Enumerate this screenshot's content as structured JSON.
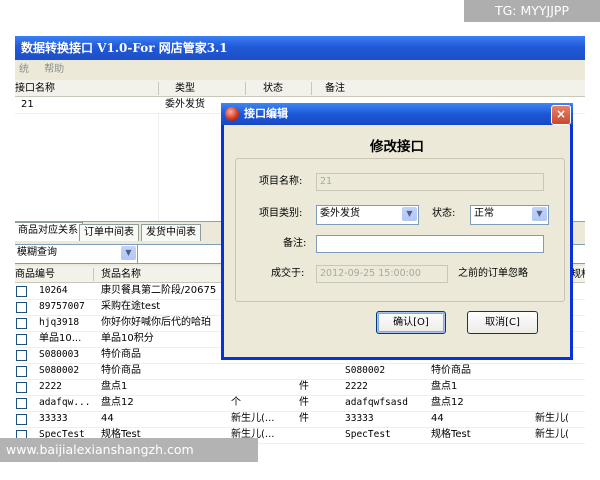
{
  "app": {
    "title": "数据转换接口 V1.0-For 网店管家3.1",
    "menu": [
      "统",
      "帮助"
    ]
  },
  "top_grid": {
    "columns": [
      "接口名称",
      "类型",
      "状态",
      "备注"
    ],
    "rows": [
      {
        "name": "21",
        "type": "委外发货",
        "status": "",
        "note": ""
      }
    ]
  },
  "tabs": [
    "商品对应关系",
    "订单中间表",
    "发货中间表"
  ],
  "filter": {
    "mode": "模糊查询",
    "text": ""
  },
  "bottom_grid": {
    "columns": [
      "商品编号",
      "货品名称",
      "",
      "",
      "",
      "",
      "",
      "规格"
    ],
    "rows": [
      [
        "10264",
        "康贝餐具第二阶段/20675",
        "",
        "",
        "",
        "",
        ""
      ],
      [
        "89757007",
        "采购在途test",
        "",
        "",
        "",
        "",
        ""
      ],
      [
        "hjq3918",
        "你好你好喊你后代的哈珀",
        "",
        "",
        "",
        "",
        ""
      ],
      [
        "单品10...",
        "单品10积分",
        "",
        "",
        "",
        "",
        ""
      ],
      [
        "S080003",
        "特价商品",
        "",
        "",
        "",
        "",
        ""
      ],
      [
        "S080002",
        "特价商品",
        "",
        "",
        "S080002",
        "特价商品",
        ""
      ],
      [
        "2222",
        "盘点1",
        "",
        "件",
        "2222",
        "盘点1",
        ""
      ],
      [
        "adafqw...",
        "盘点12",
        "个",
        "件",
        "adafqwfsasd",
        "盘点12",
        ""
      ],
      [
        "33333",
        "44",
        "新生儿(...",
        "件",
        "33333",
        "44",
        "新生儿("
      ],
      [
        "SpecTest",
        "规格Test",
        "新生儿(...",
        "",
        "SpecTest",
        "规格Test",
        "新生儿("
      ]
    ]
  },
  "dialog": {
    "title": "接口编辑",
    "heading": "修改接口",
    "name_label": "项目名称:",
    "name_value": "21",
    "type_label": "项目类别:",
    "type_value": "委外发货",
    "status_label": "状态:",
    "status_value": "正常",
    "note_label": "备注:",
    "note_value": "",
    "since_label": "成交于:",
    "since_value": "2012-09-25 15:00:00",
    "since_suffix": "之前的订单忽略",
    "ok_label": "确认[O]",
    "cancel_label": "取消[C]"
  },
  "watermarks": {
    "top": "TG: MYYJJPP",
    "bottom": "www.baijialexianshangzh.com"
  },
  "colors": {
    "title_bar": "#2259d8",
    "dialog_border": "#0831d9",
    "window_bg": "#ece9d8"
  }
}
